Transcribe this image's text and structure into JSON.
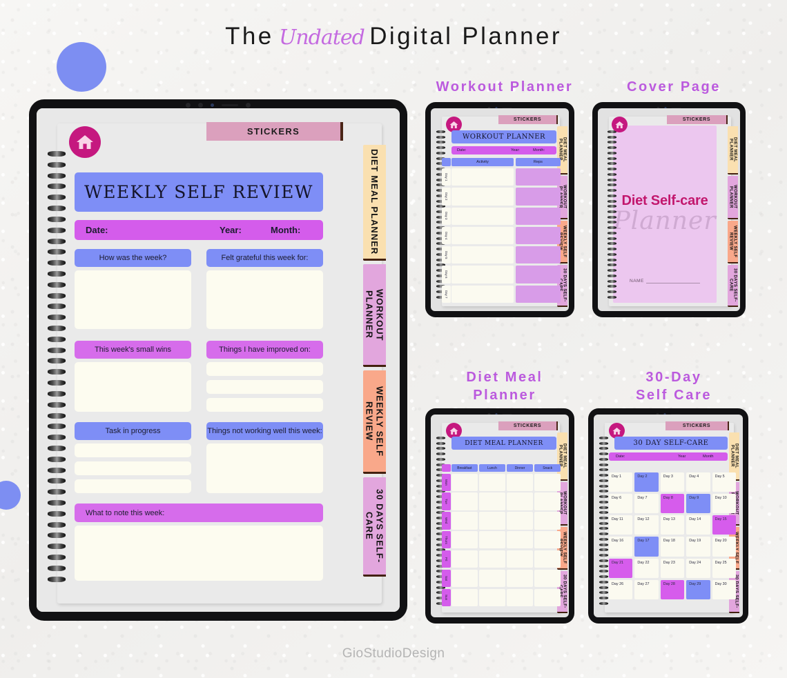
{
  "page": {
    "title_prefix": "The",
    "title_script": "Undated",
    "title_suffix": "Digital Planner",
    "footer_brand": "GioStudioDesign",
    "accent_purple": "#bb5ade",
    "accent_blue": "#7e8ef6",
    "accent_violet": "#d45ceb",
    "accent_magenta": "#c5187f"
  },
  "headings": {
    "workout": "Workout Planner",
    "cover": "Cover Page",
    "diet_line1": "Diet Meal",
    "diet_line2": "Planner",
    "thirty_line1": "30-Day",
    "thirty_line2": "Self Care"
  },
  "common": {
    "stickers_label": "STICKERS",
    "home_icon": "home-icon",
    "side_tabs": [
      {
        "label": "DIET MEAL PLANNER",
        "color": "#fae0b0"
      },
      {
        "label": "WORKOUT PLANNER",
        "color": "#e2a6dd"
      },
      {
        "label": "WEEKLY SELF REVIEW",
        "color": "#f9a88a"
      },
      {
        "label": "30 DAYS SELF-CARE",
        "color": "#e2a6dd"
      }
    ]
  },
  "weekly_review": {
    "title": "WEEKLY SELF REVIEW",
    "date_label": "Date:",
    "year_label": "Year:",
    "month_label": "Month:",
    "fields": [
      {
        "label": "How was the week?",
        "color": "blue"
      },
      {
        "label": "Felt grateful this week for:",
        "color": "blue"
      },
      {
        "label": "This week's small wins",
        "color": "orchid"
      },
      {
        "label": "Things I have improved on:",
        "color": "orchid"
      },
      {
        "label": "Task in progress",
        "color": "blue"
      },
      {
        "label": "Things not working well this week:",
        "color": "blue"
      },
      {
        "label": "What to note this week:",
        "color": "orchid"
      }
    ]
  },
  "workout_planner": {
    "title": "WORKOUT PLANNER",
    "date_label": "Date:",
    "year_label": "Year:",
    "month_label": "Month:",
    "columns": [
      "Activity",
      "Reps"
    ],
    "rows": [
      "Day 1",
      "Day 2",
      "Day 3",
      "Day 4",
      "Day 5",
      "Day 6",
      "Day 7"
    ]
  },
  "cover_page": {
    "title": "Diet Self-care",
    "script": "Planner",
    "name_label": "NAME"
  },
  "diet_meal": {
    "title": "DIET MEAL PLANNER",
    "columns": [
      "Breakfast",
      "Lunch",
      "Dinner",
      "Snack"
    ],
    "rows": [
      "Mon",
      "Tue",
      "Wed",
      "Thurs",
      "Fri",
      "Sat",
      "Sun"
    ]
  },
  "thirty_day": {
    "title": "30 DAY SELF-CARE",
    "date_label": "Date:",
    "year_label": "Year",
    "month_label": "Month",
    "days": [
      {
        "label": "Day 1",
        "hl": "none"
      },
      {
        "label": "Day 2",
        "hl": "blue"
      },
      {
        "label": "Day 3",
        "hl": "none"
      },
      {
        "label": "Day 4",
        "hl": "none"
      },
      {
        "label": "Day 5",
        "hl": "none"
      },
      {
        "label": "Day 6",
        "hl": "none"
      },
      {
        "label": "Day 7",
        "hl": "none"
      },
      {
        "label": "Day 8",
        "hl": "purple"
      },
      {
        "label": "Day 9",
        "hl": "blue"
      },
      {
        "label": "Day 10",
        "hl": "none"
      },
      {
        "label": "Day 11",
        "hl": "none"
      },
      {
        "label": "Day 12",
        "hl": "none"
      },
      {
        "label": "Day 13",
        "hl": "none"
      },
      {
        "label": "Day 14",
        "hl": "none"
      },
      {
        "label": "Day 15",
        "hl": "purple"
      },
      {
        "label": "Day 16",
        "hl": "none"
      },
      {
        "label": "Day 17",
        "hl": "blue"
      },
      {
        "label": "Day 18",
        "hl": "none"
      },
      {
        "label": "Day 19",
        "hl": "none"
      },
      {
        "label": "Day 20",
        "hl": "none"
      },
      {
        "label": "Day 21",
        "hl": "purple"
      },
      {
        "label": "Day 22",
        "hl": "none"
      },
      {
        "label": "Day 23",
        "hl": "none"
      },
      {
        "label": "Day 24",
        "hl": "none"
      },
      {
        "label": "Day 25",
        "hl": "none"
      },
      {
        "label": "Day 26",
        "hl": "none"
      },
      {
        "label": "Day 27",
        "hl": "none"
      },
      {
        "label": "Day 28",
        "hl": "purple"
      },
      {
        "label": "Day 29",
        "hl": "blue"
      },
      {
        "label": "Day 30",
        "hl": "none"
      }
    ]
  }
}
